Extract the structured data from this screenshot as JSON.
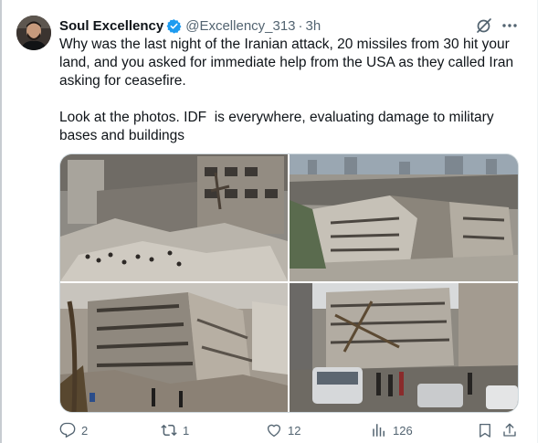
{
  "tweet": {
    "author_name": "Soul Excellency",
    "handle": "@Excellency_313",
    "separator": "·",
    "time": "3h",
    "text": "Why was the last night of the Iranian attack, 20 missiles from 30 hit your land, and you asked for immediate help from the USA as they called Iran asking for ceasefire.\n\nLook at the photos. IDF  is everywhere, evaluating damage to military bases and buildings",
    "photos": [
      {
        "icon": "rubble-crowd-photo"
      },
      {
        "icon": "aerial-destroyed-buildings-photo"
      },
      {
        "icon": "collapsed-building-photo"
      },
      {
        "icon": "damaged-street-cars-photo"
      }
    ]
  },
  "actions": {
    "replies": "2",
    "retweets": "1",
    "likes": "12",
    "views": "126"
  },
  "icons": {
    "verified": "verified-badge-icon",
    "grok": "grok-icon",
    "more": "more-icon",
    "reply": "reply-icon",
    "retweet": "retweet-icon",
    "like": "like-icon",
    "views": "views-icon",
    "bookmark": "bookmark-icon",
    "share": "share-icon"
  },
  "colors": {
    "text": "#0f1419",
    "secondary": "#536471",
    "verified": "#1d9bf0",
    "border": "#cfd9de"
  }
}
